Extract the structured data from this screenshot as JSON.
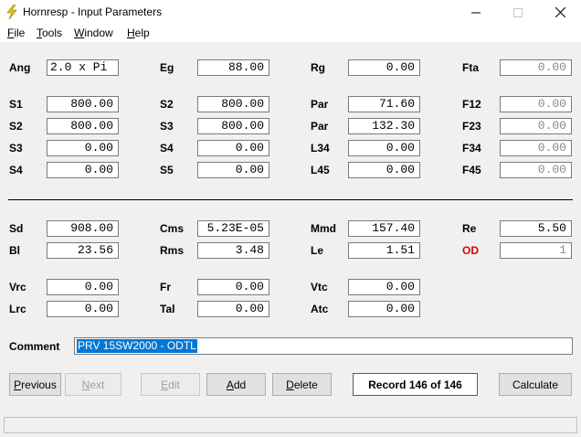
{
  "window": {
    "title": "Hornresp - Input Parameters",
    "icon": "lightning-icon",
    "controls": [
      "minimize-icon",
      "maximize-icon",
      "close-icon"
    ]
  },
  "menu": [
    {
      "first": "F",
      "rest": "ile"
    },
    {
      "first": "T",
      "rest": "ools"
    },
    {
      "first": "W",
      "rest": "indow"
    },
    {
      "first": "H",
      "rest": "elp"
    }
  ],
  "params": {
    "ang": {
      "label": "Ang",
      "value": "2.0 x Pi"
    },
    "eg": {
      "label": "Eg",
      "value": "88.00"
    },
    "rg": {
      "label": "Rg",
      "value": "0.00"
    },
    "fta": {
      "label": "Fta",
      "value": "0.00"
    },
    "s1a": {
      "label": "S1",
      "value": "800.00"
    },
    "s2a": {
      "label": "S2",
      "value": "800.00"
    },
    "par1": {
      "label": "Par",
      "value": "71.60"
    },
    "f12": {
      "label": "F12",
      "value": "0.00"
    },
    "s2b": {
      "label": "S2",
      "value": "800.00"
    },
    "s3a": {
      "label": "S3",
      "value": "800.00"
    },
    "par2": {
      "label": "Par",
      "value": "132.30"
    },
    "f23": {
      "label": "F23",
      "value": "0.00"
    },
    "s3b": {
      "label": "S3",
      "value": "0.00"
    },
    "s4a": {
      "label": "S4",
      "value": "0.00"
    },
    "l34": {
      "label": "L34",
      "value": "0.00"
    },
    "f34": {
      "label": "F34",
      "value": "0.00"
    },
    "s4b": {
      "label": "S4",
      "value": "0.00"
    },
    "s5": {
      "label": "S5",
      "value": "0.00"
    },
    "l45": {
      "label": "L45",
      "value": "0.00"
    },
    "f45": {
      "label": "F45",
      "value": "0.00"
    },
    "sd": {
      "label": "Sd",
      "value": "908.00"
    },
    "cms": {
      "label": "Cms",
      "value": "5.23E-05"
    },
    "mmd": {
      "label": "Mmd",
      "value": "157.40"
    },
    "re": {
      "label": "Re",
      "value": "5.50"
    },
    "bl": {
      "label": "Bl",
      "value": "23.56"
    },
    "rms": {
      "label": "Rms",
      "value": "3.48"
    },
    "le": {
      "label": "Le",
      "value": "1.51"
    },
    "od": {
      "label": "OD",
      "value": "1"
    },
    "vrc": {
      "label": "Vrc",
      "value": "0.00"
    },
    "fr": {
      "label": "Fr",
      "value": "0.00"
    },
    "vtc": {
      "label": "Vtc",
      "value": "0.00"
    },
    "lrc": {
      "label": "Lrc",
      "value": "0.00"
    },
    "tal": {
      "label": "Tal",
      "value": "0.00"
    },
    "atc": {
      "label": "Atc",
      "value": "0.00"
    }
  },
  "comment": {
    "label": "Comment",
    "value": "PRV 15SW2000 - ODTL"
  },
  "buttons": {
    "previous": {
      "first": "P",
      "rest": "revious"
    },
    "next": {
      "first": "N",
      "rest": "ext"
    },
    "edit": {
      "first": "E",
      "rest": "dit"
    },
    "add": {
      "first": "A",
      "rest": "dd"
    },
    "delete": {
      "first": "D",
      "rest": "elete"
    },
    "calculate": {
      "label": "Calculate"
    }
  },
  "record": "Record 146 of 146",
  "colors": {
    "od_label": "#e00000",
    "selection": "#0078d7",
    "title_icon": "#e8c800"
  }
}
